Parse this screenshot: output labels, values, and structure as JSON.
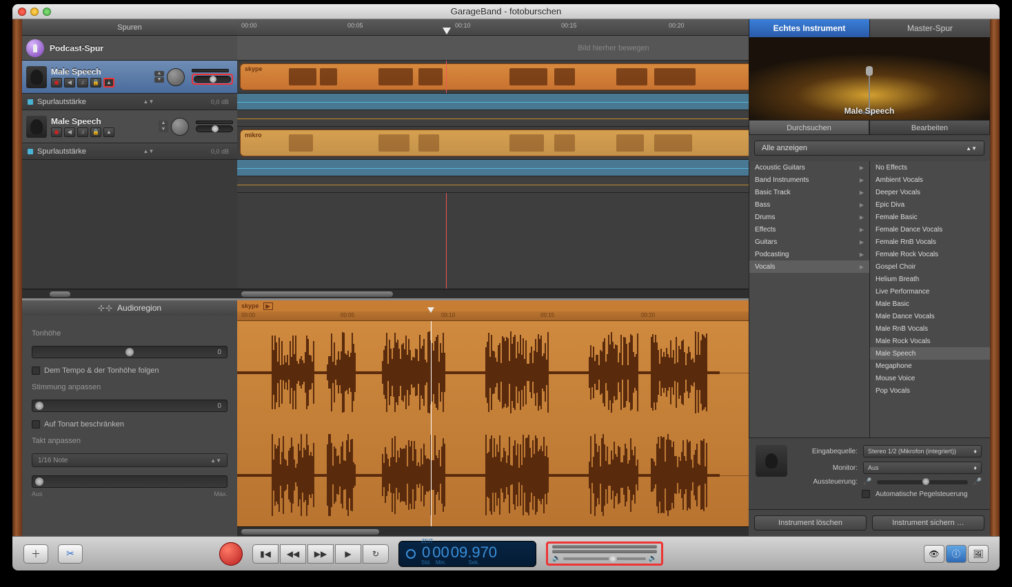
{
  "window_title": "GarageBand - fotoburschen",
  "tracks_header": "Spuren",
  "podcast_track": "Podcast-Spur",
  "podcast_drop": "Bild hierher bewegen",
  "track1": {
    "name": "Male Speech",
    "region": "skype",
    "volume_select": "Spurlautstärke",
    "db": "0,0 dB"
  },
  "track2": {
    "name": "Male Speech",
    "region": "mikro",
    "volume_select": "Spurlautstärke",
    "db": "0,0 dB"
  },
  "ruler": [
    "00:00",
    "00:05",
    "00:10",
    "00:15",
    "00:20"
  ],
  "editor": {
    "header": "Audioregion",
    "pitch_label": "Tonhöhe",
    "pitch_value": "0",
    "follow_tempo": "Dem Tempo & der Tonhöhe folgen",
    "tuning_label": "Stimmung anpassen",
    "tuning_value": "0",
    "limit_key": "Auf Tonart beschränken",
    "timing_label": "Takt anpassen",
    "timing_select": "1/16 Note",
    "min": "Aus",
    "max": "Max.",
    "region_name": "skype"
  },
  "right_panel": {
    "tab1": "Echtes Instrument",
    "tab2": "Master-Spur",
    "preview_name": "Male Speech",
    "subtab1": "Durchsuchen",
    "subtab2": "Bearbeiten",
    "filter": "Alle anzeigen",
    "categories": [
      "Acoustic Guitars",
      "Band Instruments",
      "Basic Track",
      "Bass",
      "Drums",
      "Effects",
      "Guitars",
      "Podcasting",
      "Vocals"
    ],
    "selected_category": "Vocals",
    "presets": [
      "No Effects",
      "Ambient Vocals",
      "Deeper Vocals",
      "Epic Diva",
      "Female Basic",
      "Female Dance Vocals",
      "Female RnB Vocals",
      "Female Rock Vocals",
      "Gospel Choir",
      "Helium Breath",
      "Live Performance",
      "Male Basic",
      "Male Dance Vocals",
      "Male RnB Vocals",
      "Male Rock Vocals",
      "Male Speech",
      "Megaphone",
      "Mouse Voice",
      "Pop Vocals"
    ],
    "selected_preset": "Male Speech",
    "input_label": "Eingabequelle:",
    "input_value": "Stereo 1/2 (Mikrofon (integriert))",
    "monitor_label": "Monitor:",
    "monitor_value": "Aus",
    "level_label": "Aussteuerung:",
    "auto_level": "Automatische Pegelsteuerung",
    "delete_btn": "Instrument löschen",
    "save_btn": "Instrument sichern …"
  },
  "lcd": {
    "label": "ZEIT",
    "h": "0",
    "m": "00",
    "s": "09",
    "ms": "970",
    "units": [
      "Std.",
      "Min.",
      "Sek."
    ]
  }
}
